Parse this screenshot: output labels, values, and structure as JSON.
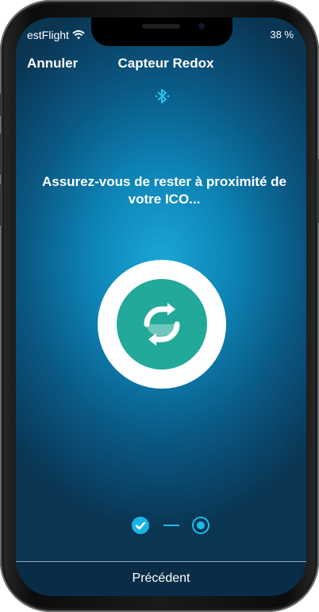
{
  "status_bar": {
    "carrier": "estFlight",
    "battery": "38 %",
    "wifi_icon": "wifi-icon"
  },
  "nav": {
    "cancel_label": "Annuler",
    "title": "Capteur Redox"
  },
  "bluetooth_icon": "bluetooth-icon",
  "message": "Assurez-vous de rester à proximité de votre ICO...",
  "sync_icon": "refresh-icon",
  "steps": {
    "total": 2,
    "completed": 1,
    "current": 2,
    "check_icon": "check-icon"
  },
  "footer": {
    "previous_label": "Précédent"
  },
  "colors": {
    "accent": "#22a99a",
    "step_blue": "#1fbce8",
    "background_center": "#1aa6d6",
    "background_edge": "#0a3553"
  }
}
